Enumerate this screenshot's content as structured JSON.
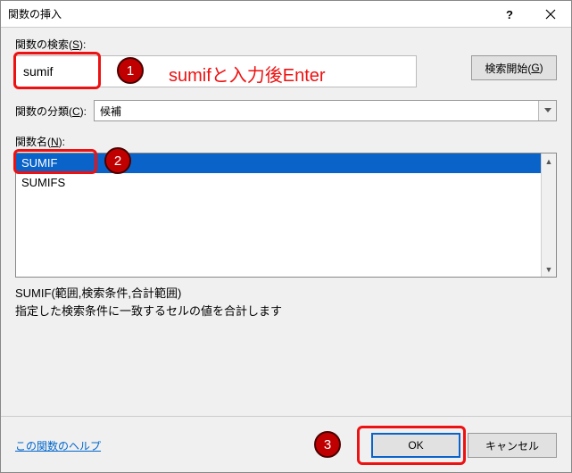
{
  "dialog": {
    "title": "関数の挿入"
  },
  "search": {
    "label": "関数の検索(S):",
    "value": "sumif",
    "go_button": "検索開始(G)"
  },
  "category": {
    "label": "関数の分類(C):",
    "selected": "候補"
  },
  "function_list": {
    "label": "関数名(N):",
    "items": [
      "SUMIF",
      "SUMIFS"
    ],
    "selected_index": 0
  },
  "description": {
    "signature": "SUMIF(範囲,検索条件,合計範囲)",
    "text": "指定した検索条件に一致するセルの値を合計します"
  },
  "footer": {
    "help_link": "この関数のヘルプ",
    "ok": "OK",
    "cancel": "キャンセル"
  },
  "annotations": {
    "hint": "sumifと入力後Enter",
    "badge1": "1",
    "badge2": "2",
    "badge3": "3"
  }
}
